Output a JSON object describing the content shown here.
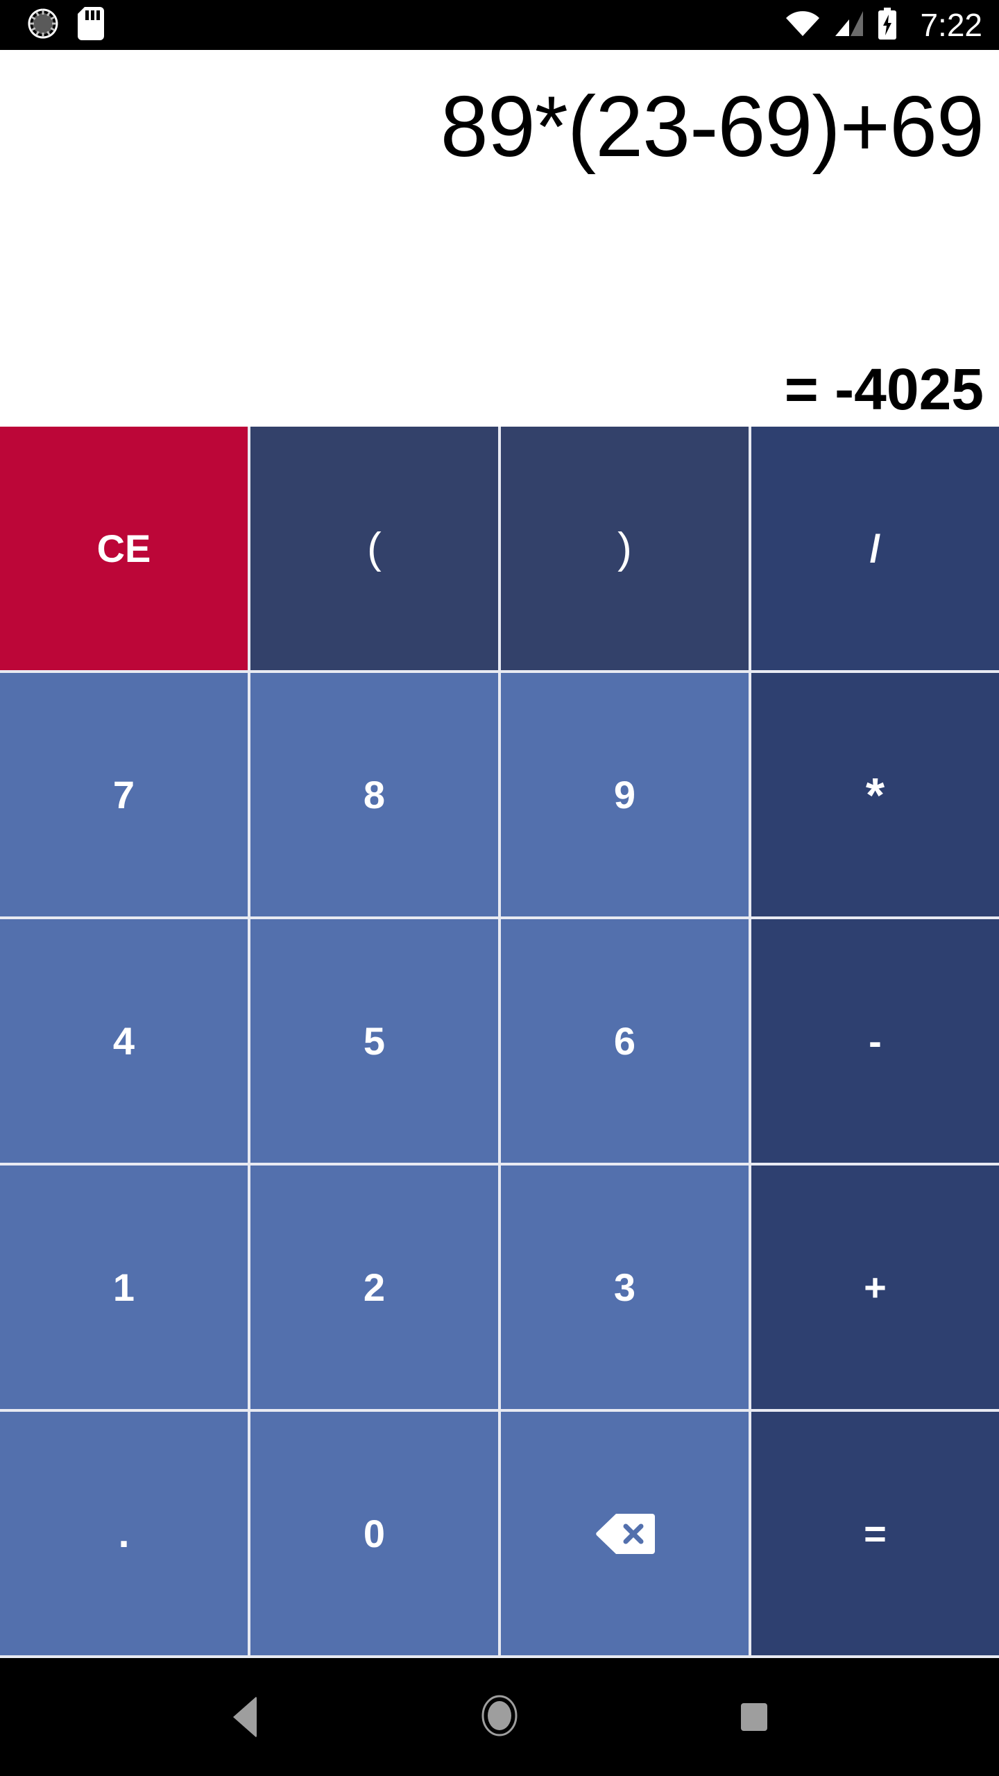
{
  "status_bar": {
    "time": "7:22",
    "left_icons": [
      "sync-spinner-icon",
      "sd-card-icon"
    ],
    "right_icons": [
      "wifi-icon",
      "cellular-signal-icon",
      "battery-charging-icon"
    ],
    "background_color": "#000000",
    "foreground_color": "#ffffff"
  },
  "display": {
    "expression": "89*(23-69)+69",
    "result": "= -4025",
    "background_color": "#ffffff",
    "text_color": "#000000"
  },
  "keypad": {
    "separator_color": "#e8eaf2",
    "colors": {
      "clear": "#bc0638",
      "paren": "#33416a",
      "operator": "#2e4070",
      "number": "#5370ad",
      "label": "#ffffff"
    },
    "keys": [
      {
        "label": "CE",
        "name": "clear-entry-button",
        "kind": "clear"
      },
      {
        "label": "(",
        "name": "open-paren-button",
        "kind": "paren"
      },
      {
        "label": ")",
        "name": "close-paren-button",
        "kind": "paren"
      },
      {
        "label": "/",
        "name": "divide-button",
        "kind": "op"
      },
      {
        "label": "7",
        "name": "digit-7-button",
        "kind": "num"
      },
      {
        "label": "8",
        "name": "digit-8-button",
        "kind": "num"
      },
      {
        "label": "9",
        "name": "digit-9-button",
        "kind": "num"
      },
      {
        "label": "*",
        "name": "multiply-button",
        "kind": "op"
      },
      {
        "label": "4",
        "name": "digit-4-button",
        "kind": "num"
      },
      {
        "label": "5",
        "name": "digit-5-button",
        "kind": "num"
      },
      {
        "label": "6",
        "name": "digit-6-button",
        "kind": "num"
      },
      {
        "label": "-",
        "name": "subtract-button",
        "kind": "op"
      },
      {
        "label": "1",
        "name": "digit-1-button",
        "kind": "num"
      },
      {
        "label": "2",
        "name": "digit-2-button",
        "kind": "num"
      },
      {
        "label": "3",
        "name": "digit-3-button",
        "kind": "num"
      },
      {
        "label": "+",
        "name": "add-button",
        "kind": "op"
      },
      {
        "label": ".",
        "name": "decimal-point-button",
        "kind": "num"
      },
      {
        "label": "0",
        "name": "digit-0-button",
        "kind": "num"
      },
      {
        "label": "",
        "name": "backspace-button",
        "kind": "num",
        "icon": "backspace-icon"
      },
      {
        "label": "=",
        "name": "equals-button",
        "kind": "op"
      }
    ]
  },
  "nav_bar": {
    "background_color": "#000000",
    "icon_color": "#9e9e9e",
    "buttons": [
      {
        "name": "nav-back-button",
        "icon": "back-triangle-icon"
      },
      {
        "name": "nav-home-button",
        "icon": "home-circle-icon"
      },
      {
        "name": "nav-recents-button",
        "icon": "recents-square-icon"
      }
    ]
  }
}
